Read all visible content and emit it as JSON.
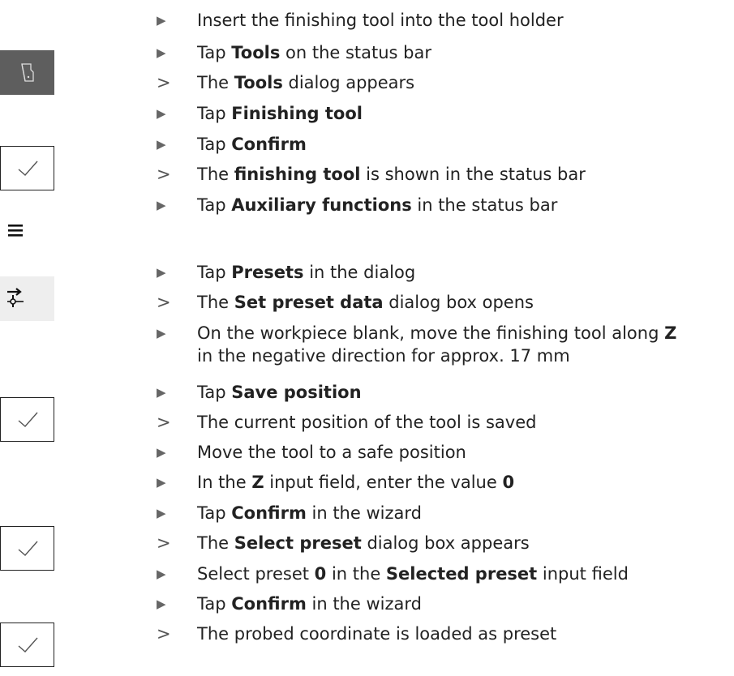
{
  "steps": [
    {
      "type": "action",
      "parts": [
        {
          "t": "Insert the finishing tool into the tool holder",
          "b": false
        }
      ]
    },
    {
      "type": "action",
      "parts": [
        {
          "t": "Tap ",
          "b": false
        },
        {
          "t": "Tools",
          "b": true
        },
        {
          "t": " on the status bar",
          "b": false
        }
      ]
    },
    {
      "type": "result",
      "parts": [
        {
          "t": "The ",
          "b": false
        },
        {
          "t": "Tools",
          "b": true
        },
        {
          "t": " dialog appears",
          "b": false
        }
      ]
    },
    {
      "type": "action",
      "parts": [
        {
          "t": "Tap ",
          "b": false
        },
        {
          "t": "Finishing tool",
          "b": true
        }
      ]
    },
    {
      "type": "action",
      "parts": [
        {
          "t": "Tap ",
          "b": false
        },
        {
          "t": "Confirm",
          "b": true
        }
      ]
    },
    {
      "type": "result",
      "parts": [
        {
          "t": "The ",
          "b": false
        },
        {
          "t": "finishing tool",
          "b": true
        },
        {
          "t": " is shown in the status bar",
          "b": false
        }
      ]
    },
    {
      "type": "action",
      "parts": [
        {
          "t": "Tap ",
          "b": false
        },
        {
          "t": "Auxiliary functions",
          "b": true
        },
        {
          "t": " in the status bar",
          "b": false
        }
      ]
    },
    {
      "type": "action",
      "parts": [
        {
          "t": "Tap ",
          "b": false
        },
        {
          "t": "Presets",
          "b": true
        },
        {
          "t": " in the dialog",
          "b": false
        }
      ]
    },
    {
      "type": "result",
      "parts": [
        {
          "t": "The ",
          "b": false
        },
        {
          "t": "Set preset data",
          "b": true
        },
        {
          "t": " dialog box opens",
          "b": false
        }
      ]
    },
    {
      "type": "action",
      "parts": [
        {
          "t": "On the workpiece blank, move the finishing tool along ",
          "b": false
        },
        {
          "t": "Z",
          "b": true
        }
      ],
      "cont": " in the negative direction for approx. 17 mm"
    },
    {
      "type": "action",
      "parts": [
        {
          "t": "Tap ",
          "b": false
        },
        {
          "t": "Save position",
          "b": true
        }
      ]
    },
    {
      "type": "result",
      "parts": [
        {
          "t": "The current position of the tool is saved",
          "b": false
        }
      ]
    },
    {
      "type": "action",
      "parts": [
        {
          "t": "Move the tool to a safe position",
          "b": false
        }
      ]
    },
    {
      "type": "action",
      "parts": [
        {
          "t": "In the ",
          "b": false
        },
        {
          "t": "Z",
          "b": true
        },
        {
          "t": " input field, enter the value ",
          "b": false
        },
        {
          "t": "0",
          "b": true
        }
      ]
    },
    {
      "type": "action",
      "parts": [
        {
          "t": "Tap ",
          "b": false
        },
        {
          "t": "Confirm",
          "b": true
        },
        {
          "t": " in the wizard",
          "b": false
        }
      ]
    },
    {
      "type": "result",
      "parts": [
        {
          "t": "The ",
          "b": false
        },
        {
          "t": "Select preset",
          "b": true
        },
        {
          "t": " dialog box appears",
          "b": false
        }
      ]
    },
    {
      "type": "action",
      "parts": [
        {
          "t": "Select preset ",
          "b": false
        },
        {
          "t": "0",
          "b": true
        },
        {
          "t": " in the ",
          "b": false
        },
        {
          "t": "Selected preset",
          "b": true
        },
        {
          "t": " input field",
          "b": false
        }
      ]
    },
    {
      "type": "action",
      "parts": [
        {
          "t": "Tap ",
          "b": false
        },
        {
          "t": "Confirm",
          "b": true
        },
        {
          "t": " in the wizard",
          "b": false
        }
      ]
    },
    {
      "type": "result",
      "parts": [
        {
          "t": "The probed coordinate is loaded as preset",
          "b": false
        }
      ]
    }
  ],
  "markers": {
    "action": "▶",
    "result": ">"
  },
  "icons": [
    {
      "name": "tools-icon",
      "style": "dark"
    },
    {
      "name": "confirm-checkmark-icon",
      "style": "outlined"
    },
    {
      "name": "auxiliary-functions-menu-icon",
      "style": "plain"
    },
    {
      "name": "presets-icon",
      "style": "light"
    },
    {
      "name": "confirm-checkmark-icon",
      "style": "outlined"
    },
    {
      "name": "confirm-checkmark-icon",
      "style": "outlined"
    },
    {
      "name": "confirm-checkmark-icon",
      "style": "outlined"
    }
  ],
  "colors": {
    "text": "#222222",
    "marker": "#666666",
    "dark_button": "#5e5e5e",
    "light_button": "#eeeeee"
  }
}
